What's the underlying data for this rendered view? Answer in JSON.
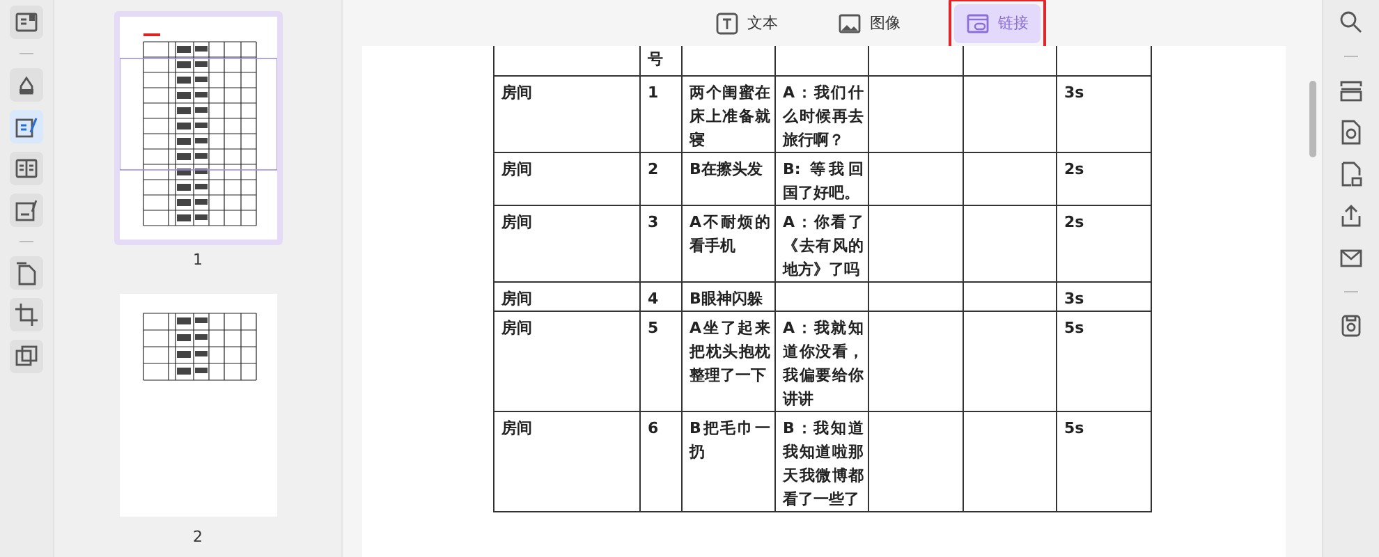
{
  "left_tools": [
    {
      "kind": "cover",
      "selected": false
    },
    {
      "kind": "divider"
    },
    {
      "kind": "highlighter",
      "selected": false
    },
    {
      "kind": "edit",
      "selected": true
    },
    {
      "kind": "columns",
      "selected": false
    },
    {
      "kind": "sign",
      "selected": false
    },
    {
      "kind": "divider"
    },
    {
      "kind": "pages",
      "selected": false
    },
    {
      "kind": "crop",
      "selected": false
    },
    {
      "kind": "layers",
      "selected": false
    }
  ],
  "thumbnails": [
    {
      "label": "1",
      "selected": true,
      "kind": "full"
    },
    {
      "label": "2",
      "selected": false,
      "kind": "short"
    }
  ],
  "edit_tabs": [
    {
      "label": "文本",
      "selected": false
    },
    {
      "label": "图像",
      "selected": false
    },
    {
      "label": "链接",
      "selected": true
    }
  ],
  "table": {
    "header": {
      "column_2": "号"
    },
    "rows": [
      {
        "cells": [
          "房间",
          "1",
          "两个闺蜜在床上准备就寝",
          "A：我们什么时候再去旅行啊？",
          "",
          "",
          "3s"
        ]
      },
      {
        "cells": [
          "房间",
          "2",
          "B在擦头发",
          "B: 等我回国了好吧。",
          "",
          "",
          "2s"
        ]
      },
      {
        "cells": [
          "房间",
          "3",
          "A不耐烦的看手机",
          "A：你看了《去有风的地方》了吗",
          "",
          "",
          "2s"
        ]
      },
      {
        "cells": [
          "房间",
          "4",
          "B眼神闪躲",
          "",
          "",
          "",
          "3s"
        ]
      },
      {
        "cells": [
          "房间",
          "5",
          "A坐了起来把枕头抱枕整理了一下",
          "A：我就知道你没看，我偏要给你讲讲",
          "",
          "",
          "5s"
        ]
      },
      {
        "cells": [
          "房间",
          "6",
          "B把毛巾一扔",
          "B：我知道我知道啦那天我微博都看了一些了",
          "",
          "",
          "5s"
        ]
      }
    ]
  },
  "right_tools": [
    {
      "kind": "search"
    },
    {
      "kind": "divider"
    },
    {
      "kind": "scan"
    },
    {
      "kind": "convert"
    },
    {
      "kind": "protect"
    },
    {
      "kind": "share"
    },
    {
      "kind": "mail"
    },
    {
      "kind": "divider"
    },
    {
      "kind": "save"
    }
  ]
}
